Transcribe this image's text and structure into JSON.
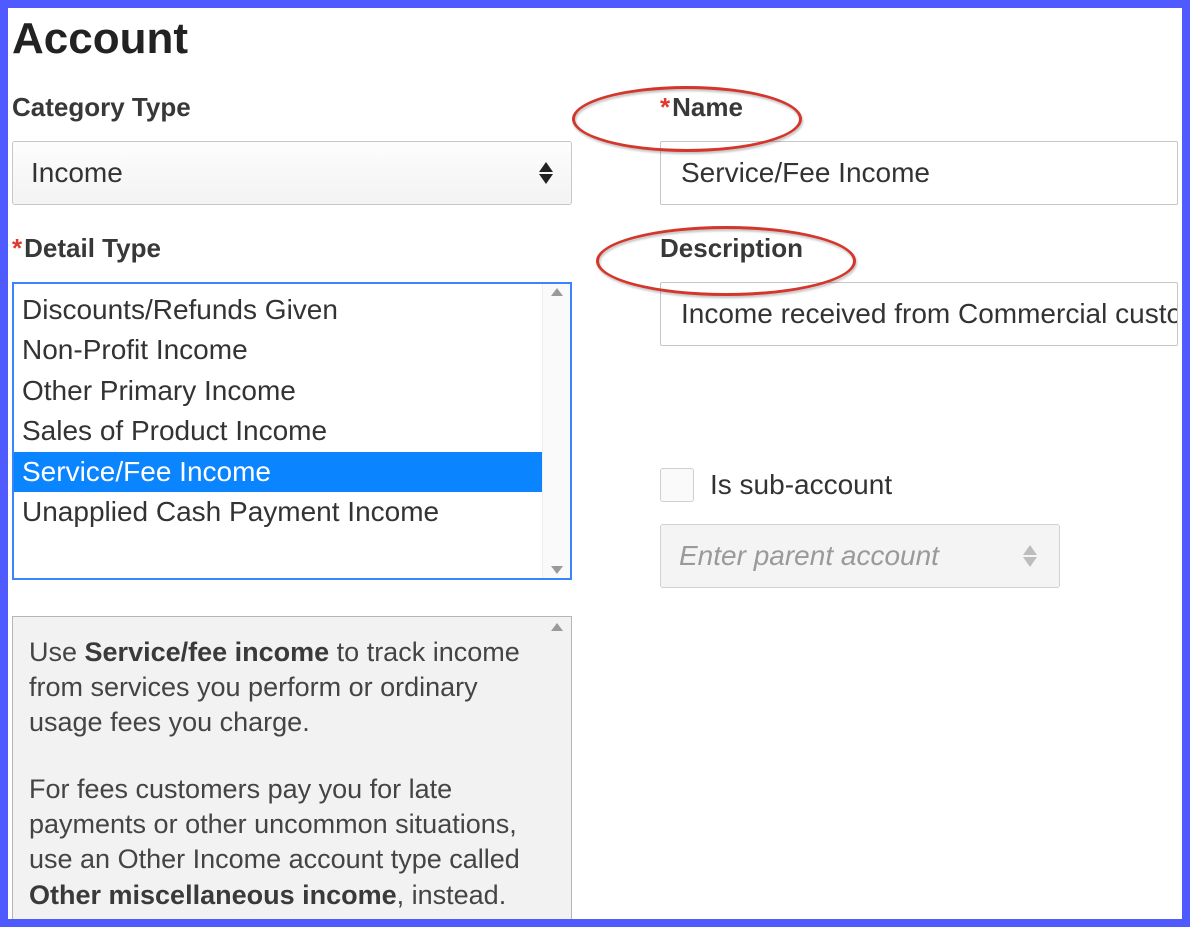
{
  "title": "Account",
  "categoryType": {
    "label": "Category Type",
    "value": "Income"
  },
  "detailType": {
    "label": "Detail Type",
    "options": [
      "Discounts/Refunds Given",
      "Non-Profit Income",
      "Other Primary Income",
      "Sales of Product Income",
      "Service/Fee Income",
      "Unapplied Cash Payment Income"
    ],
    "selectedIndex": 4
  },
  "help": {
    "p1_pre": "Use ",
    "p1_bold": "Service/fee income",
    "p1_post": " to track income from services you perform or ordinary usage fees you charge.",
    "p2_pre": "For fees customers pay you for late payments or other uncommon situations, use an Other Income account type called ",
    "p2_bold": "Other miscellaneous income",
    "p2_post": ", instead."
  },
  "name": {
    "label": "Name",
    "value": "Service/Fee Income"
  },
  "description": {
    "label": "Description",
    "value": "Income received from Commercial custo"
  },
  "subaccount": {
    "label": "Is sub-account",
    "checked": false
  },
  "parentSelect": {
    "placeholder": "Enter parent account"
  }
}
